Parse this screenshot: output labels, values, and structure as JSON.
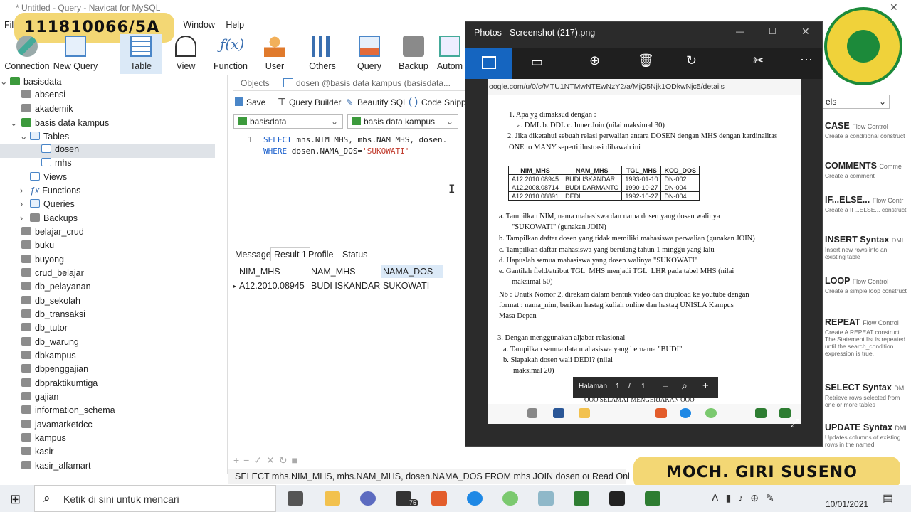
{
  "titlebar": {
    "title": "* Untitled - Query - Navicat for MySQL"
  },
  "menu": {
    "items": [
      "File",
      "Window",
      "Help"
    ]
  },
  "overlay_top": {
    "text": "111810066/5A"
  },
  "overlay_bottom": {
    "text": "MOCH. GIRI SUSENO"
  },
  "toolbar": {
    "buttons": [
      "Connection",
      "New Query",
      "Table",
      "View",
      "Function",
      "User",
      "Others",
      "Query",
      "Backup",
      "Autom"
    ]
  },
  "tree": {
    "root": "basisdata",
    "items": [
      "absensi",
      "akademik",
      "basis data kampus",
      "Tables",
      "dosen",
      "mhs",
      "Views",
      "Functions",
      "Queries",
      "Backups",
      "belajar_crud",
      "buku",
      "buyong",
      "crud_belajar",
      "db_pelayanan",
      "db_sekolah",
      "db_transaksi",
      "db_tutor",
      "db_warung",
      "dbkampus",
      "dbpenggajian",
      "dbpraktikumtiga",
      "gajian",
      "information_schema",
      "javamarketdcc",
      "kampus",
      "kasir",
      "kasir_alfamart"
    ]
  },
  "editor_tabs": {
    "objects": "Objects",
    "query_tab": "dosen @basis data kampus (basisdata..."
  },
  "query_toolbar": {
    "save": "Save",
    "builder": "Query Builder",
    "beautify": "Beautify SQL",
    "snippet": "Code Snipp"
  },
  "selectors": {
    "connection": "basisdata",
    "database": "basis data kampus"
  },
  "editor": {
    "line_no": "1",
    "line1_kw": "SELECT",
    "line1_rest": " mhs.NIM_MHS, mhs.NAM_MHS, dosen.",
    "line2_kw": "WHERE",
    "line2_rest": " dosen.NAMA_DOS=",
    "line2_str": "'SUKOWATI'"
  },
  "result_tabs": [
    "Message",
    "Result 1",
    "Profile",
    "Status"
  ],
  "result": {
    "columns": [
      "NIM_MHS",
      "NAM_MHS",
      "NAMA_DOS"
    ],
    "rows": [
      [
        "A12.2010.08945",
        "BUDI ISKANDAR",
        "SUKOWATI"
      ]
    ]
  },
  "statusbar": {
    "sql": "SELECT mhs.NIM_MHS, mhs.NAM_MHS, dosen.NAMA_DOS FROM mhs JOIN dosen on mhs.K",
    "mode": "Read Onl"
  },
  "snippets": {
    "search": "els",
    "items": [
      {
        "title": "CASE",
        "tag": "Flow Control",
        "desc": "Create a conditional construct"
      },
      {
        "title": "COMMENTS",
        "tag": "Comme",
        "desc": "Create a comment"
      },
      {
        "title": "IF...ELSE...",
        "tag": "Flow Contr",
        "desc": "Create a IF...ELSE... construct"
      },
      {
        "title": "INSERT Syntax",
        "tag": "DML",
        "desc": "Insert new rows into an existing table"
      },
      {
        "title": "LOOP",
        "tag": "Flow Control",
        "desc": "Create a simple loop construct"
      },
      {
        "title": "REPEAT",
        "tag": "Flow Control",
        "desc": "Create A REPEAT construct. The Statement list is repeated until the search_condition expression is true."
      },
      {
        "title": "SELECT Syntax",
        "tag": "DML",
        "desc": "Retrieve rows selected from one or more tables"
      },
      {
        "title": "UPDATE Syntax",
        "tag": "DML",
        "desc": "Updates columns of existing rows in the named"
      }
    ]
  },
  "photos": {
    "title": "Photos - Screenshot (217).png",
    "url": "oogle.com/u/0/c/MTU1NTMwNTEwNzY2/a/MjQ5Njk1ODkwNjc5/details",
    "lines": [
      "1.   Apa yg dimaksud dengan :",
      "a. DML     b. DDL     c. Inner Join (nilai maksimal 30)",
      "2.  Jika diketahui sebuah relasi perwalian antara DOSEN dengan MHS dengan kardinalitas",
      "ONE to MANY seperti ilustrasi dibawah ini",
      "a.   Tampilkan NIM, nama mahasiswa dan nama dosen yang dosen walinya",
      "\"SUKOWATI\" (gunakan JOIN)",
      "b.   Tampilkan daftar dosen yang tidak memiliki mahasiswa perwalian (gunakan JOIN)",
      "c.   Tampilkan daftar mahasiswa yang berulang tahun 1 minggu yang lalu",
      "d.   Hapuslah semua mahasiswa yang dosen walinya \"SUKOWATI\"",
      "e.   Gantilah field/atribut TGL_MHS menjadi TGL_LHR pada tabel MHS (nilai",
      "maksimal 50)",
      "Nb : Unutk Nomor 2, direkam dalam bentuk video dan diupload ke youtube dengan",
      "format : nama_nim, berikan hastag kuliah online dan hastag UNISLA Kampus",
      "Masa Depan",
      "3.   Dengan menggunakan aljabar relasional",
      "a.  Tampilkan semua data mahasiswa yang bernama \"BUDI\"",
      "b.  Siapakah dosen wali DEDI? (nilai",
      "maksimal 20)",
      "OOO SELAMAT MENGERJAKAN OOO"
    ],
    "table": {
      "columns": [
        "NIM_MHS",
        "NAM_MHS",
        "TGL_MHS",
        "KOD_DOS"
      ],
      "rows": [
        [
          "A12.2010.08945",
          "BUDI ISKANDAR",
          "1993-01-10",
          "DN-002"
        ],
        [
          "A12.2008.08714",
          "BUDI DARMANTO",
          "1990-10-27",
          "DN-004"
        ],
        [
          "A12.2010.08891",
          "DEDI",
          "1992-10-27",
          "DN-004"
        ]
      ]
    },
    "pager": {
      "label": "Halaman",
      "current": "1",
      "sep": "/",
      "total": "1"
    }
  },
  "taskbar": {
    "search_placeholder": "Ketik di sini untuk mencari",
    "date": "10/01/2021",
    "mail_badge": "75"
  }
}
